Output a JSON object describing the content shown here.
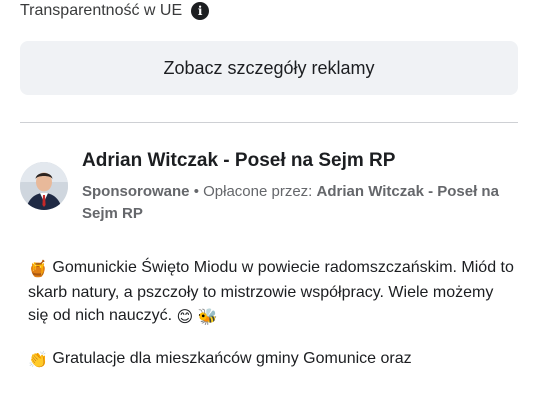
{
  "transparency": {
    "label": "Transparentność w UE",
    "info_icon": "info-icon"
  },
  "ad_details_button": {
    "label": "Zobacz szczegóły reklamy"
  },
  "post": {
    "author": "Adrian Witczak - Poseł na Sejm RP",
    "sponsored_label": "Sponsorowane",
    "separator": "•",
    "paid_by_prefix": "Opłacone przez:",
    "paid_by_name": "Adrian Witczak - Poseł na Sejm RP",
    "paragraph1": {
      "emoji": "🍯",
      "text": "Gomunickie Święto Miodu w powiecie radomszczańskim. Miód to skarb natury, a pszczoły to mistrzowie współpracy. Wiele możemy się od nich nauczyć.",
      "trailing_emojis": "😊 🐝"
    },
    "paragraph2": {
      "emoji": "👏",
      "text": "Gratulacje dla mieszkańców gminy Gomunice oraz"
    }
  },
  "colors": {
    "button_bg": "#f0f2f5",
    "text_primary": "#1c1e21",
    "text_secondary": "#65676b",
    "divider": "#ced0d4"
  }
}
